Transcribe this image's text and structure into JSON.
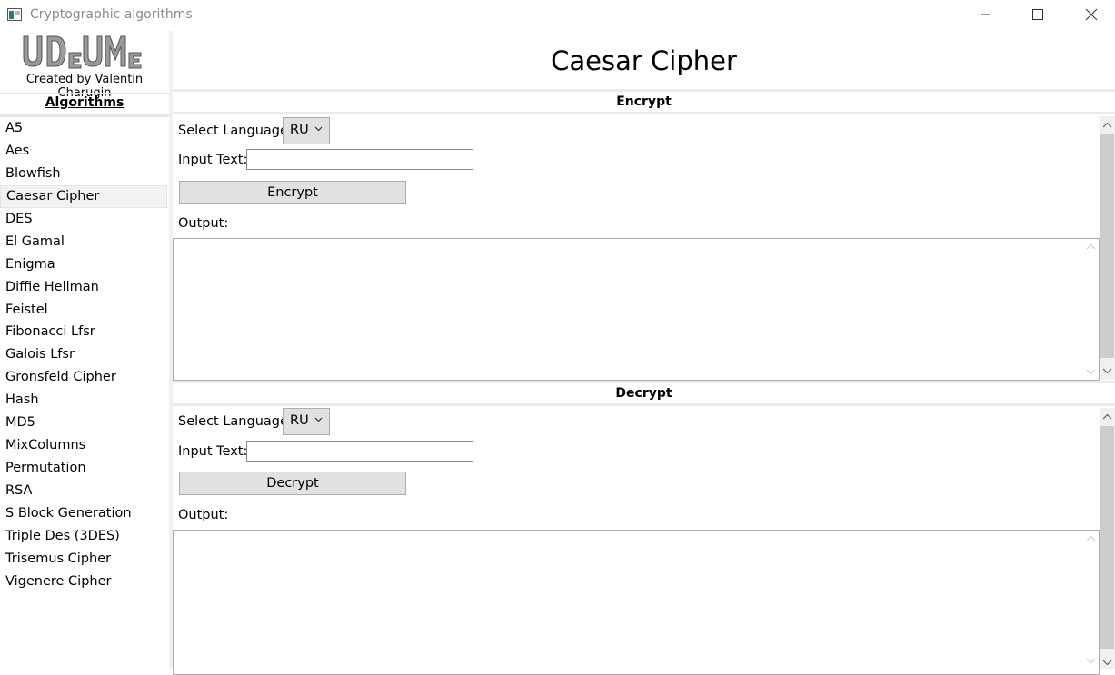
{
  "window": {
    "title": "Cryptographic algorithms",
    "icons": [
      "app-icon",
      "minimize-icon",
      "maximize-icon",
      "close-icon"
    ]
  },
  "sidebar": {
    "logo_text": "UDEUME",
    "credit": "Created by Valentin Charugin",
    "header": "Algorithms",
    "selected": "Caesar Cipher",
    "items": [
      "A5",
      "Aes",
      "Blowfish",
      "Caesar Cipher",
      "DES",
      "El Gamal",
      "Enigma",
      "Diffie Hellman",
      "Feistel",
      "Fibonacci Lfsr",
      "Galois Lfsr",
      "Gronsfeld Cipher",
      "Hash",
      "MD5",
      "MixColumns",
      "Permutation",
      "RSA",
      "S Block Generation",
      "Triple Des (3DES)",
      "Trisemus Cipher",
      "Vigenere Cipher"
    ]
  },
  "main": {
    "title": "Caesar Cipher",
    "encrypt": {
      "header": "Encrypt",
      "language_label": "Select Language",
      "language_value": "RU",
      "input_label": "Input Text:",
      "input_value": "",
      "button": "Encrypt",
      "output_label": "Output:",
      "output_value": ""
    },
    "decrypt": {
      "header": "Decrypt",
      "language_label": "Select Language",
      "language_value": "RU",
      "input_label": "Input Text:",
      "input_value": "",
      "button": "Decrypt",
      "output_label": "Output:",
      "output_value": ""
    }
  },
  "colors": {
    "title_text": "#8a8a8a",
    "button_bg": "#e1e1e1",
    "separator": "#ebebeb",
    "scrollbar_thumb": "#cdcdcd"
  }
}
